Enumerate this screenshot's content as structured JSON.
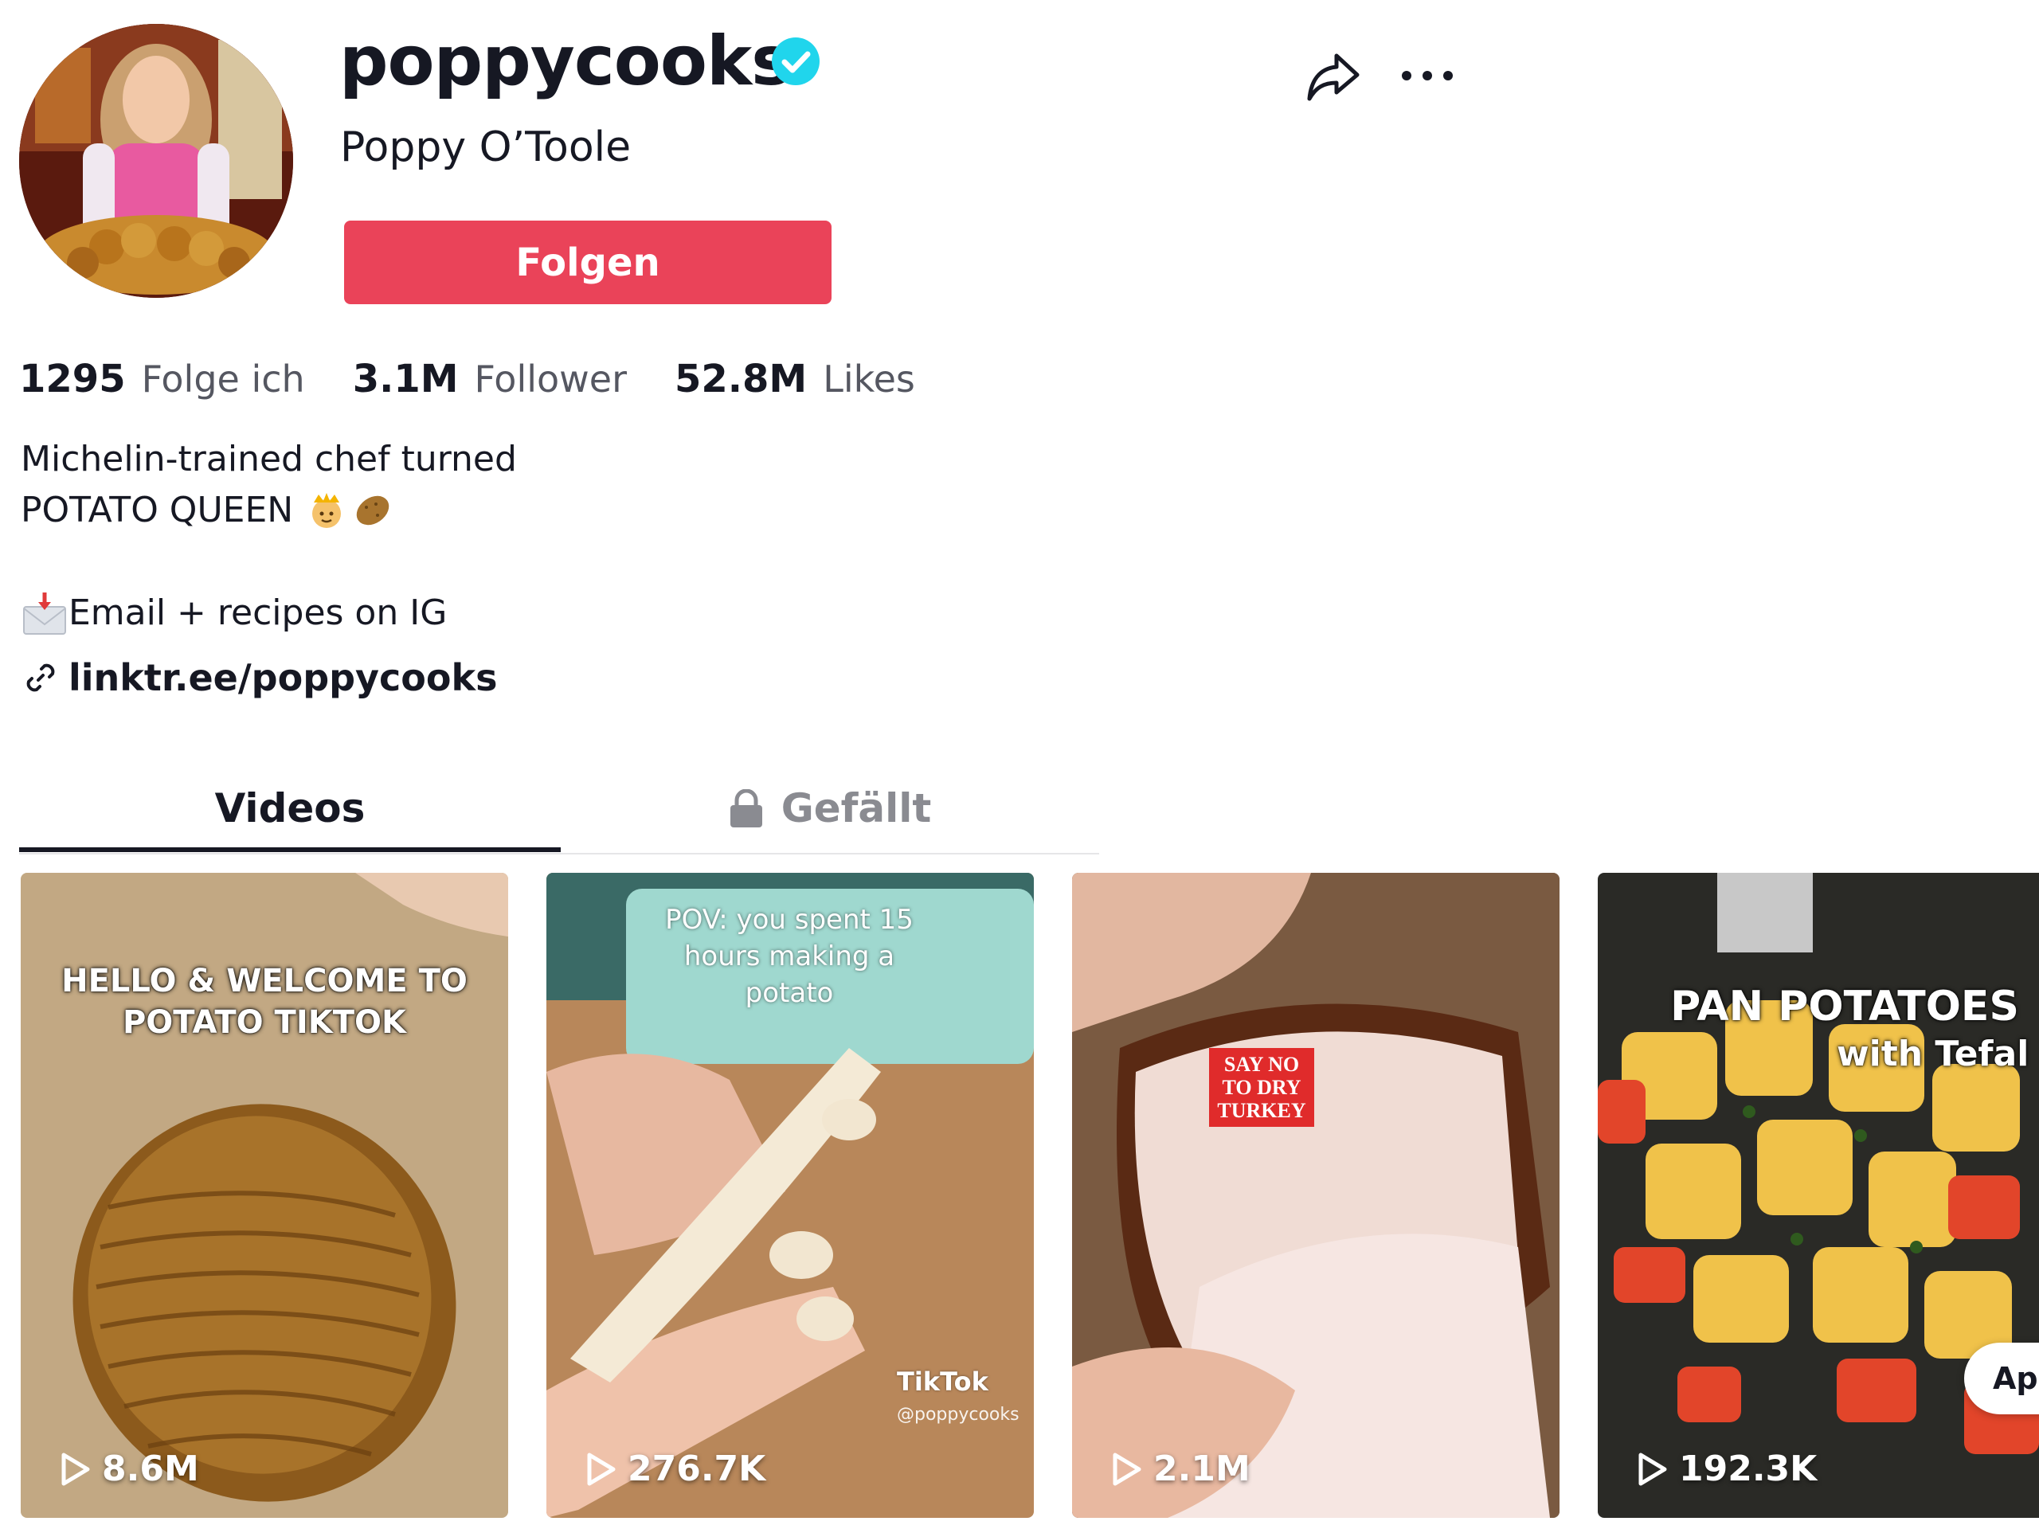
{
  "profile": {
    "username": "poppycooks",
    "nickname": "Poppy O’Toole",
    "follow_label": "Folgen"
  },
  "stats": [
    {
      "value": "1295",
      "label": "Folge ich"
    },
    {
      "value": "3.1M",
      "label": "Follower"
    },
    {
      "value": "52.8M",
      "label": "Likes"
    }
  ],
  "bio": {
    "line1": "Michelin-trained chef turned",
    "line2": "POTATO QUEEN",
    "line3": "Email + recipes on IG",
    "link": "linktr.ee/poppycooks"
  },
  "tabs": [
    {
      "label": "Videos",
      "active": true
    },
    {
      "label": "Gefällt",
      "active": false,
      "icon": "lock-icon"
    }
  ],
  "videos": [
    {
      "views": "8.6M",
      "caption": "HELLO & WELCOME TO POTATO TIKTOK"
    },
    {
      "views": "276.7K",
      "caption": "POV: you spent 15 hours making a potato",
      "watermark": "TikTok",
      "handle": "@poppycooks"
    },
    {
      "views": "2.1M",
      "caption": "SAY NO TO DRY TURKEY"
    },
    {
      "views": "192.3K",
      "caption": "PAN POTATOES",
      "subcaption": "with Tefal"
    }
  ],
  "app_button": "Ap",
  "colors": {
    "accent": "#ea4359",
    "verified": "#20d5ec",
    "text": "#161823",
    "muted": "#555761"
  },
  "icons": [
    "verified-badge-icon",
    "share-icon",
    "more-icon",
    "link-icon",
    "lock-icon",
    "play-icon",
    "envelope-icon",
    "crown-emoji-icon",
    "potato-emoji-icon"
  ]
}
